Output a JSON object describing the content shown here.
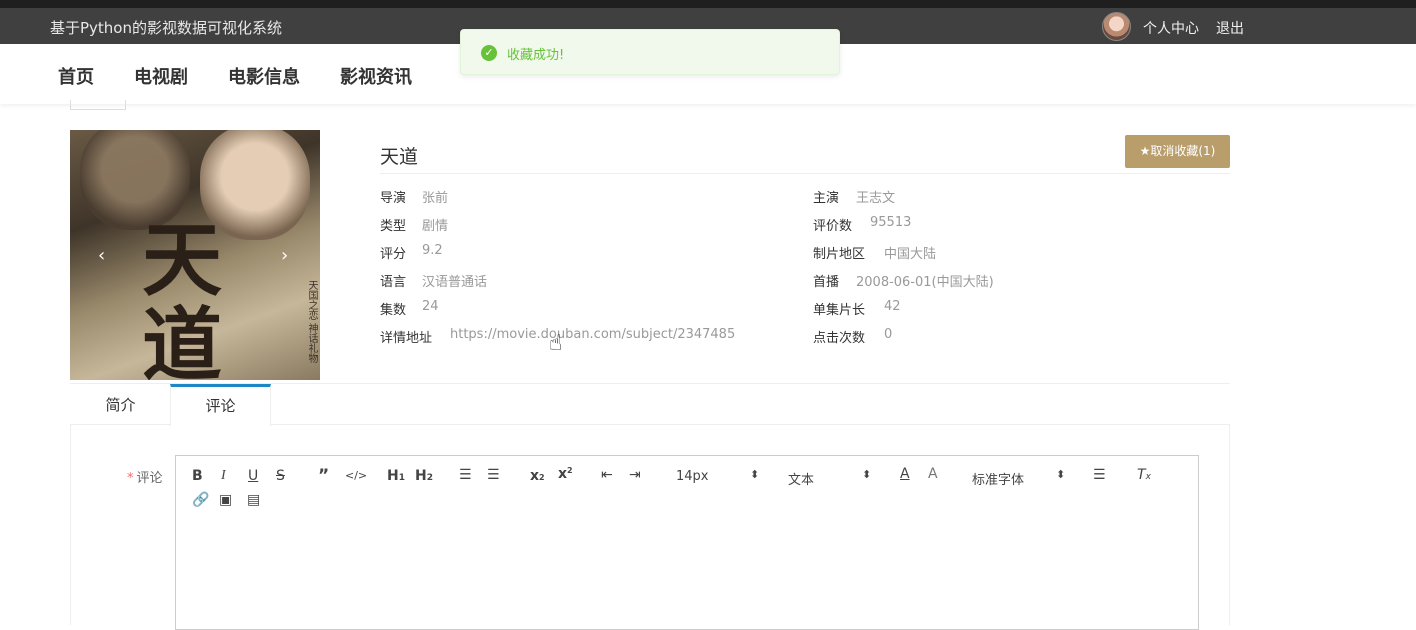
{
  "header": {
    "site_title": "基于Python的影视数据可视化系统",
    "user_center": "个人中心",
    "logout": "退出"
  },
  "nav": {
    "items": [
      "首页",
      "电视剧",
      "电影信息",
      "影视资讯"
    ]
  },
  "toast": {
    "message": "收藏成功!",
    "icon": "check-circle-icon",
    "color": "#67c23a"
  },
  "poster": {
    "big_char_1": "天",
    "big_char_2": "道",
    "side_text": "天国之恋 神话礼物",
    "prev": "‹",
    "next": "›"
  },
  "detail": {
    "title": "天道",
    "favorite_button": "★取消收藏(1)",
    "left": [
      {
        "label": "导演",
        "value": "张前"
      },
      {
        "label": "类型",
        "value": "剧情"
      },
      {
        "label": "评分",
        "value": "9.2"
      },
      {
        "label": "语言",
        "value": "汉语普通话"
      },
      {
        "label": "集数",
        "value": "24"
      },
      {
        "label": "详情地址",
        "value": "https://movie.douban.com/subject/2347485"
      }
    ],
    "right": [
      {
        "label": "主演",
        "value": "王志文"
      },
      {
        "label": "评价数",
        "value": "95513"
      },
      {
        "label": "制片地区",
        "value": "中国大陆"
      },
      {
        "label": "首播",
        "value": "2008-06-01(中国大陆)"
      },
      {
        "label": "单集片长",
        "value": "42"
      },
      {
        "label": "点击次数",
        "value": "0"
      }
    ]
  },
  "tabs": [
    {
      "label": "简介",
      "active": false
    },
    {
      "label": "评论",
      "active": true
    }
  ],
  "comment_form": {
    "required_mark": "*",
    "label": "评论",
    "font_size": "14px",
    "text_type": "文本",
    "font_family": "标准字体"
  },
  "colors": {
    "accent": "#1e88c7",
    "favorite": "#b99d6b",
    "topbar": "#404040"
  }
}
